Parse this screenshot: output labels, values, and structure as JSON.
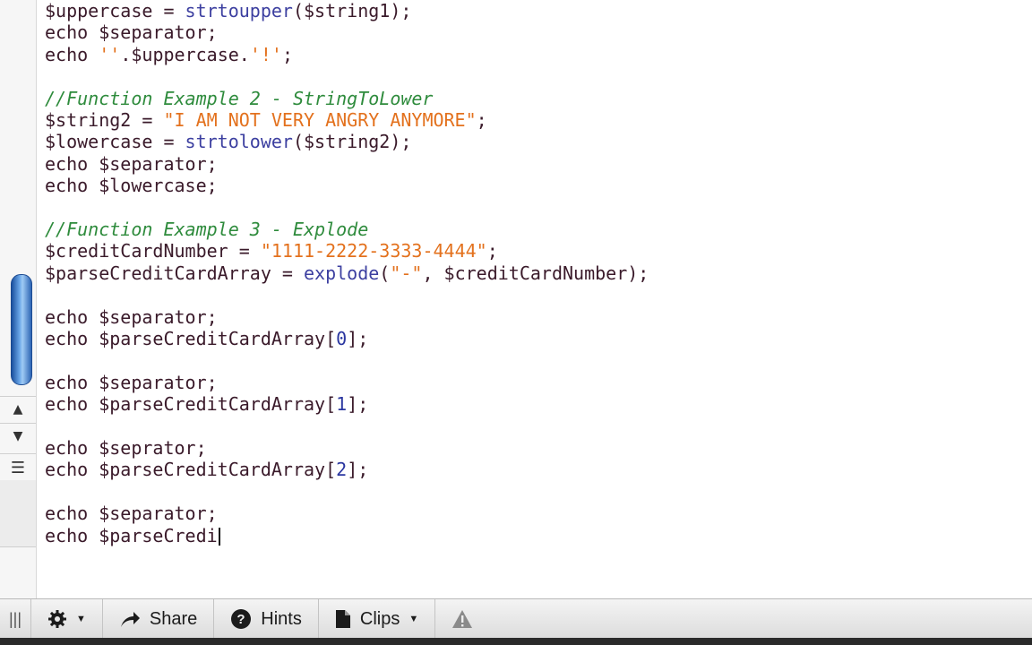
{
  "editor": {
    "lines": [
      {
        "tokens": [
          [
            "var",
            "$uppercase"
          ],
          [
            "punc",
            " = "
          ],
          [
            "fn",
            "strtoupper"
          ],
          [
            "punc",
            "($string1);"
          ]
        ]
      },
      {
        "tokens": [
          [
            "kw",
            "echo "
          ],
          [
            "var",
            "$separator"
          ],
          [
            "punc",
            ";"
          ]
        ]
      },
      {
        "tokens": [
          [
            "kw",
            "echo "
          ],
          [
            "str",
            "''"
          ],
          [
            "punc",
            "."
          ],
          [
            "var",
            "$uppercase"
          ],
          [
            "punc",
            "."
          ],
          [
            "str",
            "'!'"
          ],
          [
            "punc",
            ";"
          ]
        ]
      },
      {
        "tokens": []
      },
      {
        "tokens": [
          [
            "com",
            "//Function Example 2 - StringToLower"
          ]
        ]
      },
      {
        "tokens": [
          [
            "var",
            "$string2"
          ],
          [
            "punc",
            " = "
          ],
          [
            "str",
            "\"I AM NOT VERY ANGRY ANYMORE\""
          ],
          [
            "punc",
            ";"
          ]
        ]
      },
      {
        "tokens": [
          [
            "var",
            "$lowercase"
          ],
          [
            "punc",
            " = "
          ],
          [
            "fn",
            "strtolower"
          ],
          [
            "punc",
            "($string2);"
          ]
        ]
      },
      {
        "tokens": [
          [
            "kw",
            "echo "
          ],
          [
            "var",
            "$separator"
          ],
          [
            "punc",
            ";"
          ]
        ]
      },
      {
        "tokens": [
          [
            "kw",
            "echo "
          ],
          [
            "var",
            "$lowercase"
          ],
          [
            "punc",
            ";"
          ]
        ]
      },
      {
        "tokens": []
      },
      {
        "tokens": [
          [
            "com",
            "//Function Example 3 - Explode"
          ]
        ]
      },
      {
        "tokens": [
          [
            "var",
            "$creditCardNumber"
          ],
          [
            "punc",
            " = "
          ],
          [
            "str",
            "\"1111-2222-3333-4444\""
          ],
          [
            "punc",
            ";"
          ]
        ]
      },
      {
        "tokens": [
          [
            "var",
            "$parseCreditCardArray"
          ],
          [
            "punc",
            " = "
          ],
          [
            "fn",
            "explode"
          ],
          [
            "punc",
            "("
          ],
          [
            "str",
            "\"-\""
          ],
          [
            "punc",
            ", $creditCardNumber);"
          ]
        ]
      },
      {
        "tokens": []
      },
      {
        "tokens": [
          [
            "kw",
            "echo "
          ],
          [
            "var",
            "$separator"
          ],
          [
            "punc",
            ";"
          ]
        ]
      },
      {
        "tokens": [
          [
            "kw",
            "echo "
          ],
          [
            "var",
            "$parseCreditCardArray"
          ],
          [
            "punc",
            "["
          ],
          [
            "num",
            "0"
          ],
          [
            "punc",
            "];"
          ]
        ]
      },
      {
        "tokens": []
      },
      {
        "tokens": [
          [
            "kw",
            "echo "
          ],
          [
            "var",
            "$separator"
          ],
          [
            "punc",
            ";"
          ]
        ]
      },
      {
        "tokens": [
          [
            "kw",
            "echo "
          ],
          [
            "var",
            "$parseCreditCardArray"
          ],
          [
            "punc",
            "["
          ],
          [
            "num",
            "1"
          ],
          [
            "punc",
            "];"
          ]
        ]
      },
      {
        "tokens": []
      },
      {
        "tokens": [
          [
            "kw",
            "echo "
          ],
          [
            "var",
            "$seprator"
          ],
          [
            "punc",
            ";"
          ]
        ]
      },
      {
        "tokens": [
          [
            "kw",
            "echo "
          ],
          [
            "var",
            "$parseCreditCardArray"
          ],
          [
            "punc",
            "["
          ],
          [
            "num",
            "2"
          ],
          [
            "punc",
            "];"
          ]
        ]
      },
      {
        "tokens": []
      },
      {
        "tokens": [
          [
            "kw",
            "echo "
          ],
          [
            "var",
            "$separator"
          ],
          [
            "punc",
            ";"
          ]
        ]
      },
      {
        "tokens": [
          [
            "kw",
            "echo "
          ],
          [
            "var",
            "$parseCredi"
          ]
        ],
        "caret": true
      }
    ]
  },
  "gutter": {
    "up_icon": "triangle-up-icon",
    "down_icon": "triangle-down-icon",
    "menu_icon": "hamburger-icon"
  },
  "toolbar": {
    "share_label": "Share",
    "hints_label": "Hints",
    "clips_label": "Clips"
  },
  "colors": {
    "keyword": "#3a1a2a",
    "function": "#3c3fa0",
    "string": "#e3711d",
    "number": "#2a36a0",
    "comment": "#2e8b3c"
  }
}
